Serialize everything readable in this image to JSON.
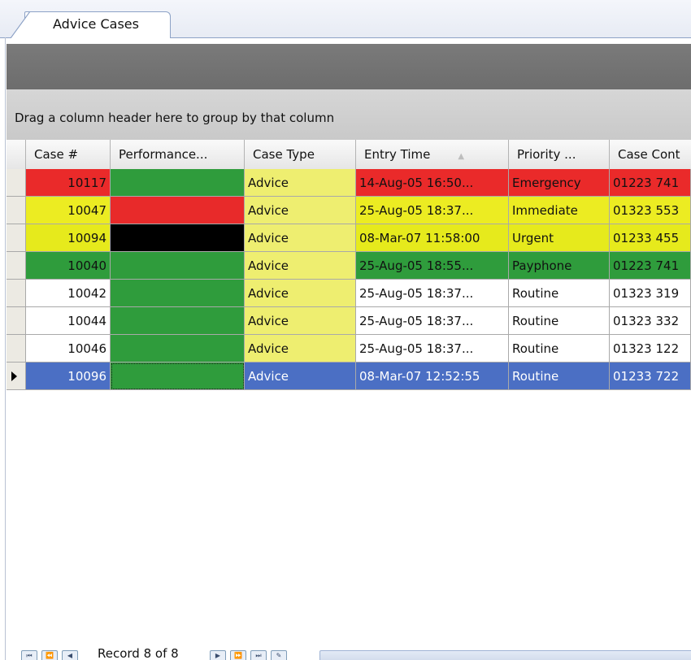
{
  "tab": {
    "label": "Advice Cases"
  },
  "group_panel": {
    "hint": "Drag a column header here to group by that column"
  },
  "columns": [
    "Case #",
    "Performance...",
    "Case Type",
    "Entry Time",
    "Priority ...",
    "Case Cont"
  ],
  "sorted_column": "Entry Time",
  "sort_direction": "ascending",
  "rows": [
    {
      "case": "10117",
      "performance_color": "#2f9c3c",
      "type": "Advice",
      "entry": "14-Aug-05 16:50...",
      "priority": "Emergency",
      "contact": "01223 741",
      "row_color": "#ea2a2a",
      "text_color": "#111111",
      "selected": false
    },
    {
      "case": "10047",
      "performance_color": "#e82a2a",
      "type": "Advice",
      "entry": "25-Aug-05 18:37...",
      "priority": "Immediate",
      "contact": "01323 553",
      "row_color": "#ecec22",
      "text_color": "#111111",
      "selected": false
    },
    {
      "case": "10094",
      "performance_color": "#000000",
      "type": "Advice",
      "entry": "08-Mar-07 11:58:00",
      "priority": "Urgent",
      "contact": "01233 455",
      "row_color": "#e6ea1c",
      "text_color": "#111111",
      "selected": false
    },
    {
      "case": "10040",
      "performance_color": "#2f9c3c",
      "type": "Advice",
      "entry": "25-Aug-05 18:55...",
      "priority": "Payphone",
      "contact": "01223 741",
      "row_color": "#2f9c3c",
      "text_color": "#111111",
      "selected": false
    },
    {
      "case": "10042",
      "performance_color": "#2f9c3c",
      "type": "Advice",
      "entry": "25-Aug-05 18:37...",
      "priority": "Routine",
      "contact": "01323 319",
      "row_color": "#ffffff",
      "text_color": "#111111",
      "selected": false
    },
    {
      "case": "10044",
      "performance_color": "#2f9c3c",
      "type": "Advice",
      "entry": "25-Aug-05 18:37...",
      "priority": "Routine",
      "contact": "01323 332",
      "row_color": "#ffffff",
      "text_color": "#111111",
      "selected": false
    },
    {
      "case": "10046",
      "performance_color": "#2f9c3c",
      "type": "Advice",
      "entry": "25-Aug-05 18:37...",
      "priority": "Routine",
      "contact": "01323 122",
      "row_color": "#ffffff",
      "text_color": "#111111",
      "selected": false
    },
    {
      "case": "10096",
      "performance_color": "#2f9c3c",
      "type": "Advice",
      "entry": "08-Mar-07 12:52:55",
      "priority": "Routine",
      "contact": "01233 722",
      "row_color": "#4b6fc4",
      "text_color": "#ffffff",
      "selected": true
    }
  ],
  "case_type_bg": "#eeee70",
  "navigator": {
    "text": "Record 8 of 8"
  }
}
